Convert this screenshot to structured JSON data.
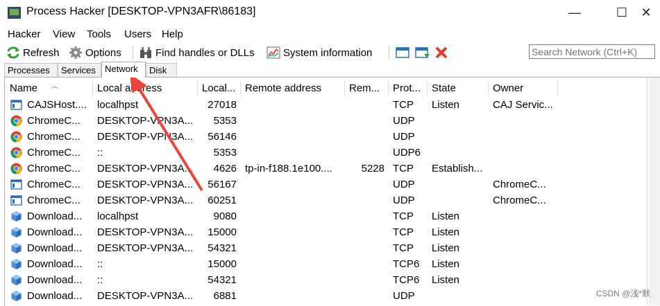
{
  "window": {
    "title": "Process Hacker [DESKTOP-VPN3AFR\\86183]",
    "minimize_glyph": "—",
    "maximize_glyph": "☐",
    "close_glyph": "✕"
  },
  "menu": [
    "Hacker",
    "View",
    "Tools",
    "Users",
    "Help"
  ],
  "toolbar": {
    "refresh": "Refresh",
    "options": "Options",
    "find_handles": "Find handles or DLLs",
    "system_information": "System information"
  },
  "search": {
    "placeholder": "Search Network (Ctrl+K)"
  },
  "tabs": [
    "Processes",
    "Services",
    "Network",
    "Disk"
  ],
  "active_tab": "Network",
  "columns": [
    "Name",
    "Local address",
    "Local...",
    "Remote address",
    "Rem...",
    "Prot...",
    "State",
    "Owner"
  ],
  "rows": [
    {
      "icon": "app-window-icon",
      "name": "CAJSHost....",
      "local_address": "localhpst",
      "local_port": "27018",
      "remote_address": "",
      "remote_port": "",
      "protocol": "TCP",
      "state": "Listen",
      "owner": "CAJ Servic..."
    },
    {
      "icon": "chrome-icon",
      "name": "ChromeC...",
      "local_address": "DESKTOP-VPN3A...",
      "local_port": "5353",
      "remote_address": "",
      "remote_port": "",
      "protocol": "UDP",
      "state": "",
      "owner": ""
    },
    {
      "icon": "chrome-icon",
      "name": "ChromeC...",
      "local_address": "DESKTOP-VPN3A...",
      "local_port": "56146",
      "remote_address": "",
      "remote_port": "",
      "protocol": "UDP",
      "state": "",
      "owner": ""
    },
    {
      "icon": "chrome-icon",
      "name": "ChromeC...",
      "local_address": "::",
      "local_port": "5353",
      "remote_address": "",
      "remote_port": "",
      "protocol": "UDP6",
      "state": "",
      "owner": ""
    },
    {
      "icon": "chrome-icon",
      "name": "ChromeC...",
      "local_address": "DESKTOP-VPN3A...",
      "local_port": "4626",
      "remote_address": "tp-in-f188.1e100....",
      "remote_port": "5228",
      "protocol": "TCP",
      "state": "Establish...",
      "owner": ""
    },
    {
      "icon": "app-window-icon",
      "name": "ChromeC...",
      "local_address": "DESKTOP-VPN3A...",
      "local_port": "56167",
      "remote_address": "",
      "remote_port": "",
      "protocol": "UDP",
      "state": "",
      "owner": "ChromeC..."
    },
    {
      "icon": "app-window-icon",
      "name": "ChromeC...",
      "local_address": "DESKTOP-VPN3A...",
      "local_port": "60251",
      "remote_address": "",
      "remote_port": "",
      "protocol": "UDP",
      "state": "",
      "owner": "ChromeC..."
    },
    {
      "icon": "cube-icon",
      "name": "Download...",
      "local_address": "localhpst",
      "local_port": "9080",
      "remote_address": "",
      "remote_port": "",
      "protocol": "TCP",
      "state": "Listen",
      "owner": ""
    },
    {
      "icon": "cube-icon",
      "name": "Download...",
      "local_address": "DESKTOP-VPN3A...",
      "local_port": "15000",
      "remote_address": "",
      "remote_port": "",
      "protocol": "TCP",
      "state": "Listen",
      "owner": ""
    },
    {
      "icon": "cube-icon",
      "name": "Download...",
      "local_address": "DESKTOP-VPN3A...",
      "local_port": "54321",
      "remote_address": "",
      "remote_port": "",
      "protocol": "TCP",
      "state": "Listen",
      "owner": ""
    },
    {
      "icon": "cube-icon",
      "name": "Download...",
      "local_address": "::",
      "local_port": "15000",
      "remote_address": "",
      "remote_port": "",
      "protocol": "TCP6",
      "state": "Listen",
      "owner": ""
    },
    {
      "icon": "cube-icon",
      "name": "Download...",
      "local_address": "::",
      "local_port": "54321",
      "remote_address": "",
      "remote_port": "",
      "protocol": "TCP6",
      "state": "Listen",
      "owner": ""
    },
    {
      "icon": "cube-icon",
      "name": "Download...",
      "local_address": "DESKTOP-VPN3A...",
      "local_port": "6881",
      "remote_address": "",
      "remote_port": "",
      "protocol": "UDP",
      "state": "",
      "owner": ""
    }
  ],
  "watermark": "CSDN @浅*默",
  "colors": {
    "annotation_arrow": "#e8453c",
    "chrome_red": "#db4437",
    "chrome_green": "#0f9d58",
    "chrome_yellow": "#f4b400",
    "chrome_blue": "#4285f4"
  }
}
